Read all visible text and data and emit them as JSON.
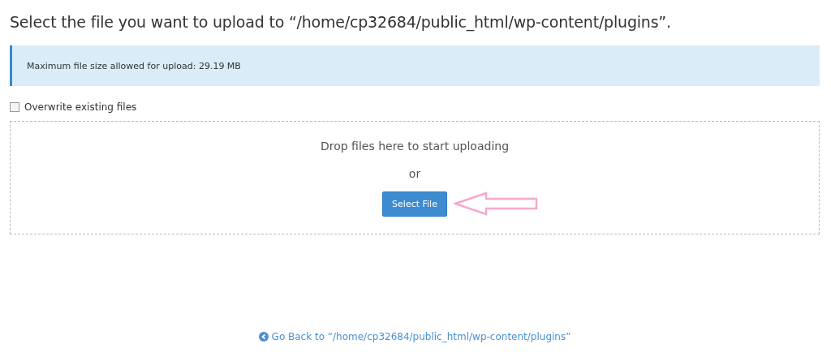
{
  "title": "Select the file you want to upload to “/home/cp32684/public_html/wp-content/plugins”.",
  "info": "Maximum file size allowed for upload: 29.19 MB",
  "overwrite": {
    "label": "Overwrite existing files",
    "checked": false
  },
  "dropzone": {
    "prompt": "Drop files here to start uploading",
    "or": "or",
    "button": "Select File"
  },
  "back_link": "Go Back to “/home/cp32684/public_html/wp-content/plugins”"
}
